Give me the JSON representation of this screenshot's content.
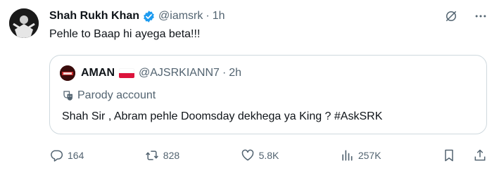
{
  "tweet": {
    "author_name": "Shah Rukh Khan",
    "handle": "@iamsrk",
    "separator": "·",
    "time": "1h",
    "text": "Pehle to Baap hi ayega beta!!!"
  },
  "top_icons": [
    "grok-icon",
    "more-icon"
  ],
  "quoted": {
    "author_name": "AMAN",
    "handle": "@AJSRKIANN7",
    "separator": "·",
    "time": "2h",
    "label": "Parody account",
    "text": "Shah Sir , Abram pehle Doomsday dekhega ya King ? #AskSRK"
  },
  "actions": {
    "replies": "164",
    "reposts": "828",
    "likes": "5.8K",
    "views": "257K"
  },
  "colors": {
    "text": "#0f1419",
    "muted": "#536471",
    "verified": "#1d9bf0",
    "border": "#cfd9de"
  }
}
